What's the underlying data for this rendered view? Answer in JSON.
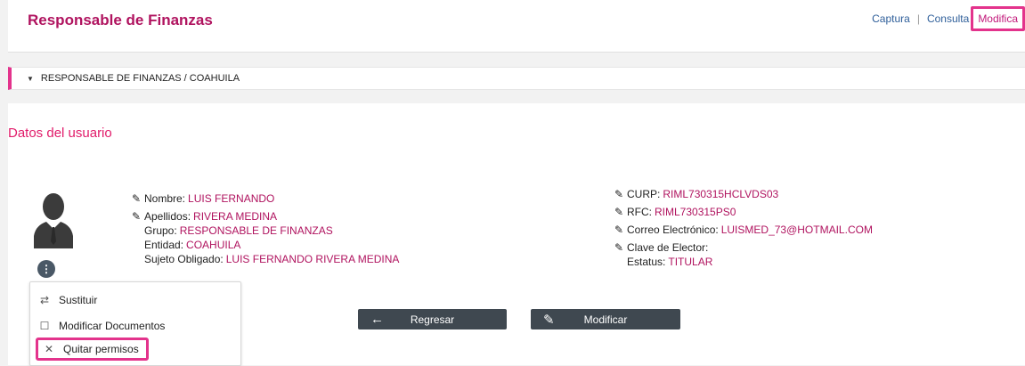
{
  "header": {
    "title": "Responsable de Finanzas",
    "nav": [
      {
        "label": "Captura"
      },
      {
        "label": "Consulta"
      },
      {
        "label": "Modifica"
      }
    ]
  },
  "section": {
    "label": "RESPONSABLE DE FINANZAS / COAHUILA"
  },
  "card": {
    "title": "Datos del usuario",
    "left": {
      "nombre_label": "Nombre:",
      "nombre": "LUIS FERNANDO",
      "apellidos_label": "Apellidos:",
      "apellidos": "RIVERA MEDINA",
      "grupo_label": "Grupo:",
      "grupo": "RESPONSABLE DE FINANZAS",
      "entidad_label": "Entidad:",
      "entidad": "COAHUILA",
      "sujeto_label": "Sujeto Obligado:",
      "sujeto": "LUIS FERNANDO RIVERA MEDINA"
    },
    "right": {
      "curp_label": "CURP:",
      "curp": "RIML730315HCLVDS03",
      "rfc_label": "RFC:",
      "rfc": "RIML730315PS0",
      "correo_label": "Correo Electrónico:",
      "correo": "LUISMED_73@HOTMAIL.COM",
      "clave_label": "Clave de Elector:",
      "clave": "",
      "estatus_label": "Estatus:",
      "estatus": "TITULAR"
    }
  },
  "menu": {
    "items": [
      {
        "label": "Sustituir",
        "icon": "swap-icon"
      },
      {
        "label": "Modificar Documentos",
        "icon": "document-icon"
      },
      {
        "label": "Quitar permisos",
        "icon": "close-icon"
      }
    ]
  },
  "buttons": {
    "back": "Regresar",
    "modify": "Modificar"
  },
  "colors": {
    "accent": "#e3338c",
    "value_text": "#b0135f",
    "button_bg": "#3f4850",
    "link": "#2f5f9a"
  }
}
